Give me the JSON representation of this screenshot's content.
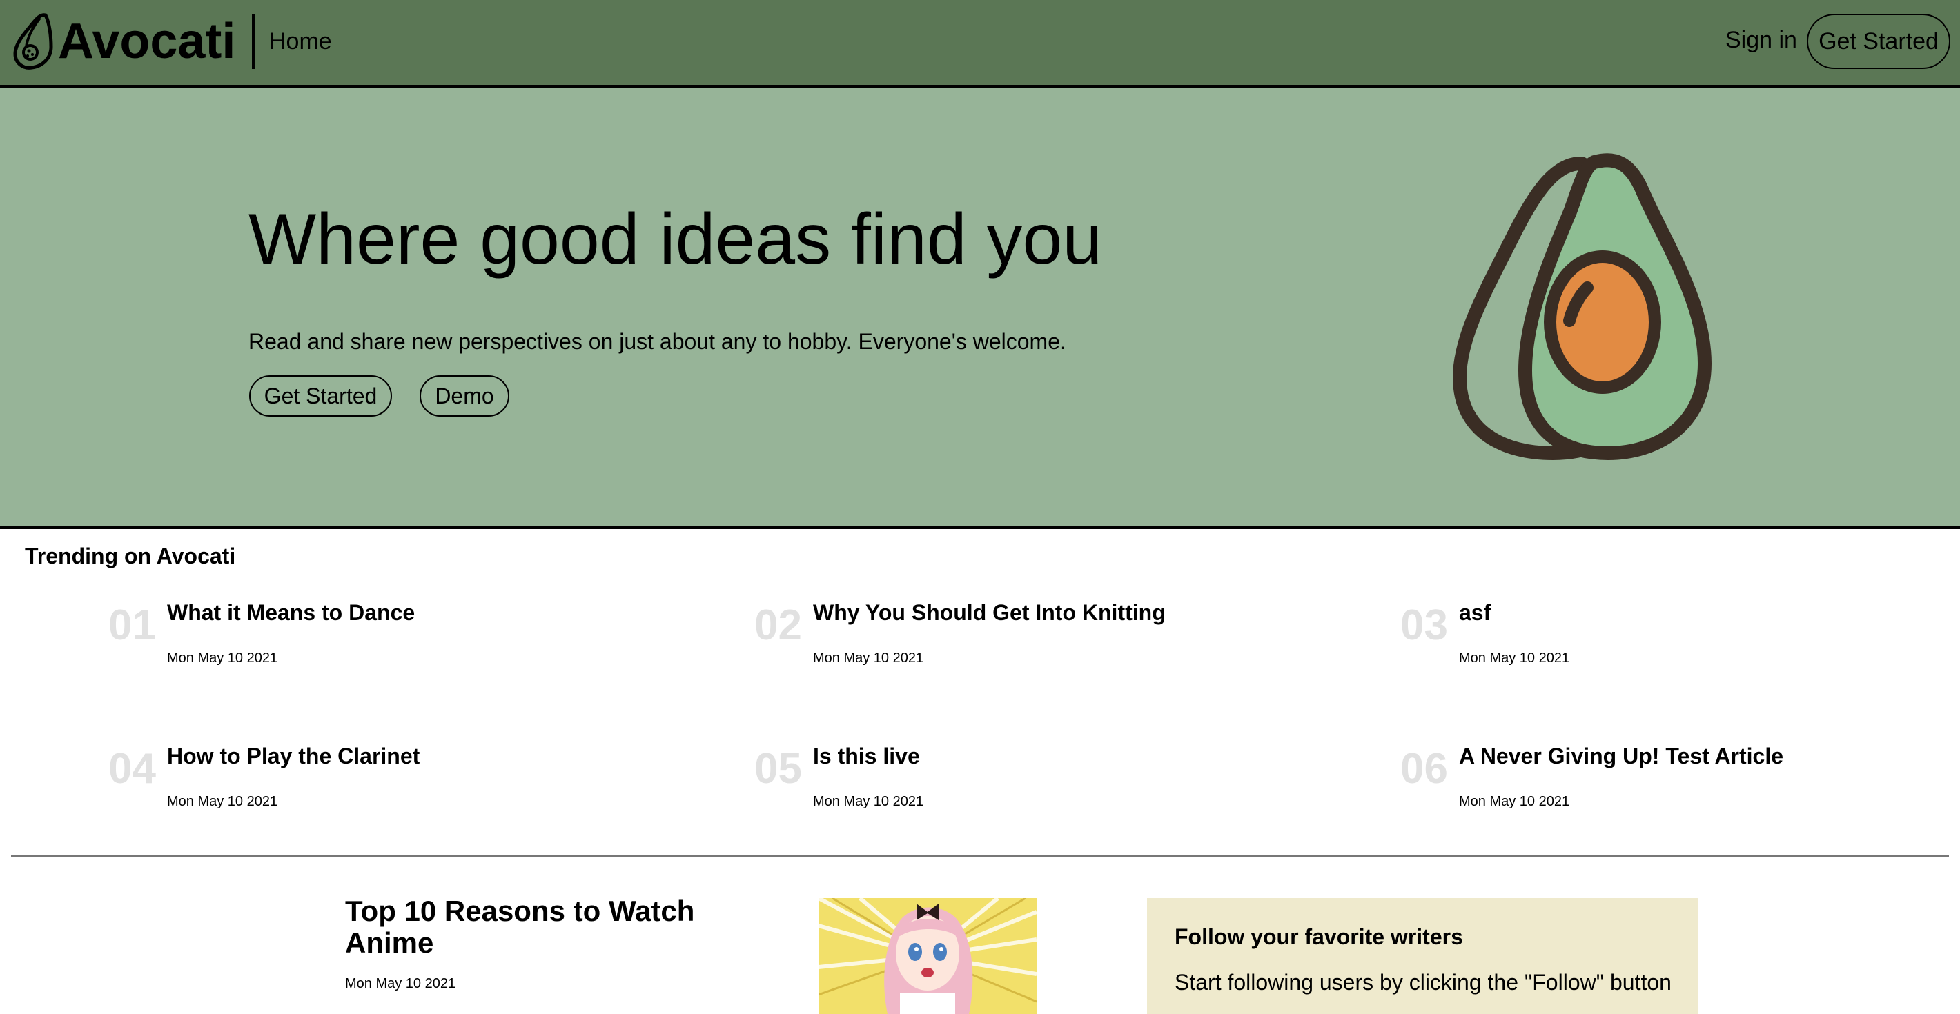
{
  "header": {
    "brand": "Avocati",
    "nav_home": "Home",
    "sign_in": "Sign in",
    "get_started": "Get Started",
    "logo_icon": "avocado-logo-icon",
    "bg_color": "#5b7755"
  },
  "hero": {
    "title": "Where good ideas find you",
    "subtitle": "Read and share new perspectives on just about any to hobby. Everyone's welcome.",
    "buttons": {
      "get_started": "Get Started",
      "demo": "Demo"
    },
    "illustration_icon": "avocado-icon",
    "bg_color": "#97b498"
  },
  "trending": {
    "title": "Trending on Avocati",
    "items": [
      {
        "num": "01",
        "title": "What it Means to Dance",
        "date": "Mon May 10 2021"
      },
      {
        "num": "02",
        "title": "Why You Should Get Into Knitting",
        "date": "Mon May 10 2021"
      },
      {
        "num": "03",
        "title": "asf",
        "date": "Mon May 10 2021"
      },
      {
        "num": "04",
        "title": "How to Play the Clarinet",
        "date": "Mon May 10 2021"
      },
      {
        "num": "05",
        "title": "Is this live",
        "date": "Mon May 10 2021"
      },
      {
        "num": "06",
        "title": "A Never Giving Up! Test Article",
        "date": "Mon May 10 2021"
      }
    ]
  },
  "feed": {
    "article": {
      "title": "Top 10 Reasons to Watch Anime",
      "date": "Mon May 10 2021"
    },
    "follow": {
      "title": "Follow your favorite writers",
      "text": "Start following users by clicking the \"Follow\" button"
    }
  }
}
